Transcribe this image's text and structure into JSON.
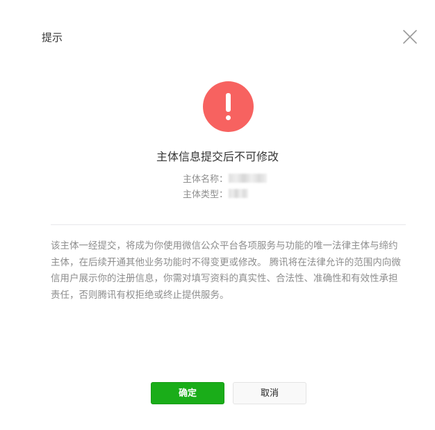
{
  "dialog": {
    "title": "提示",
    "close_icon": "close-icon"
  },
  "warning": {
    "icon": "exclamation-icon",
    "color": "#f76260",
    "headline": "主体信息提交后不可修改"
  },
  "entity": {
    "name_label": "主体名称：",
    "type_label": "主体类型："
  },
  "notice": {
    "text": "该主体一经提交，将成为你使用微信公众平台各项服务与功能的唯一法律主体与缔约主体，在后续开通其他业务功能时不得变更或修改。 腾讯将在法律允许的范围内向微信用户展示你的注册信息，你需对填写资料的真实性、合法性、准确性和有效性承担责任，否则腾讯有权拒绝或终止提供服务。"
  },
  "buttons": {
    "confirm_label": "确定",
    "cancel_label": "取消",
    "confirm_color": "#1aad19"
  }
}
